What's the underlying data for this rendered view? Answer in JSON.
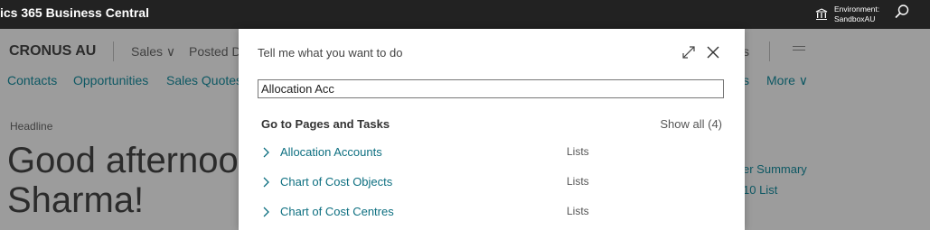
{
  "app": {
    "title": "ics 365 Business Central",
    "environment_label": "Environment:",
    "environment_name": "SandboxAU"
  },
  "background_page": {
    "company": "CRONUS AU",
    "menu": {
      "sales": "Sales",
      "posted": "Posted D",
      "right_fragment": "s"
    },
    "nav": {
      "contacts": "Contacts",
      "opportunities": "Opportunities",
      "sales_quotes": "Sales Quotes",
      "right_fragment": "s",
      "more": "More"
    },
    "headline_label": "Headline",
    "greeting_line1": "Good afternoo",
    "greeting_line2": "Sharma!",
    "right_links": [
      "er Summary",
      "10 List"
    ]
  },
  "dialog": {
    "title": "Tell me what you want to do",
    "search": {
      "value": "Allocation Acc",
      "placeholder": ""
    },
    "section_title": "Go to Pages and Tasks",
    "show_all": "Show all (4)",
    "results": [
      {
        "name": "Allocation Accounts",
        "category": "Lists"
      },
      {
        "name": "Chart of Cost Objects",
        "category": "Lists"
      },
      {
        "name": "Chart of Cost Centres",
        "category": "Lists"
      }
    ]
  }
}
